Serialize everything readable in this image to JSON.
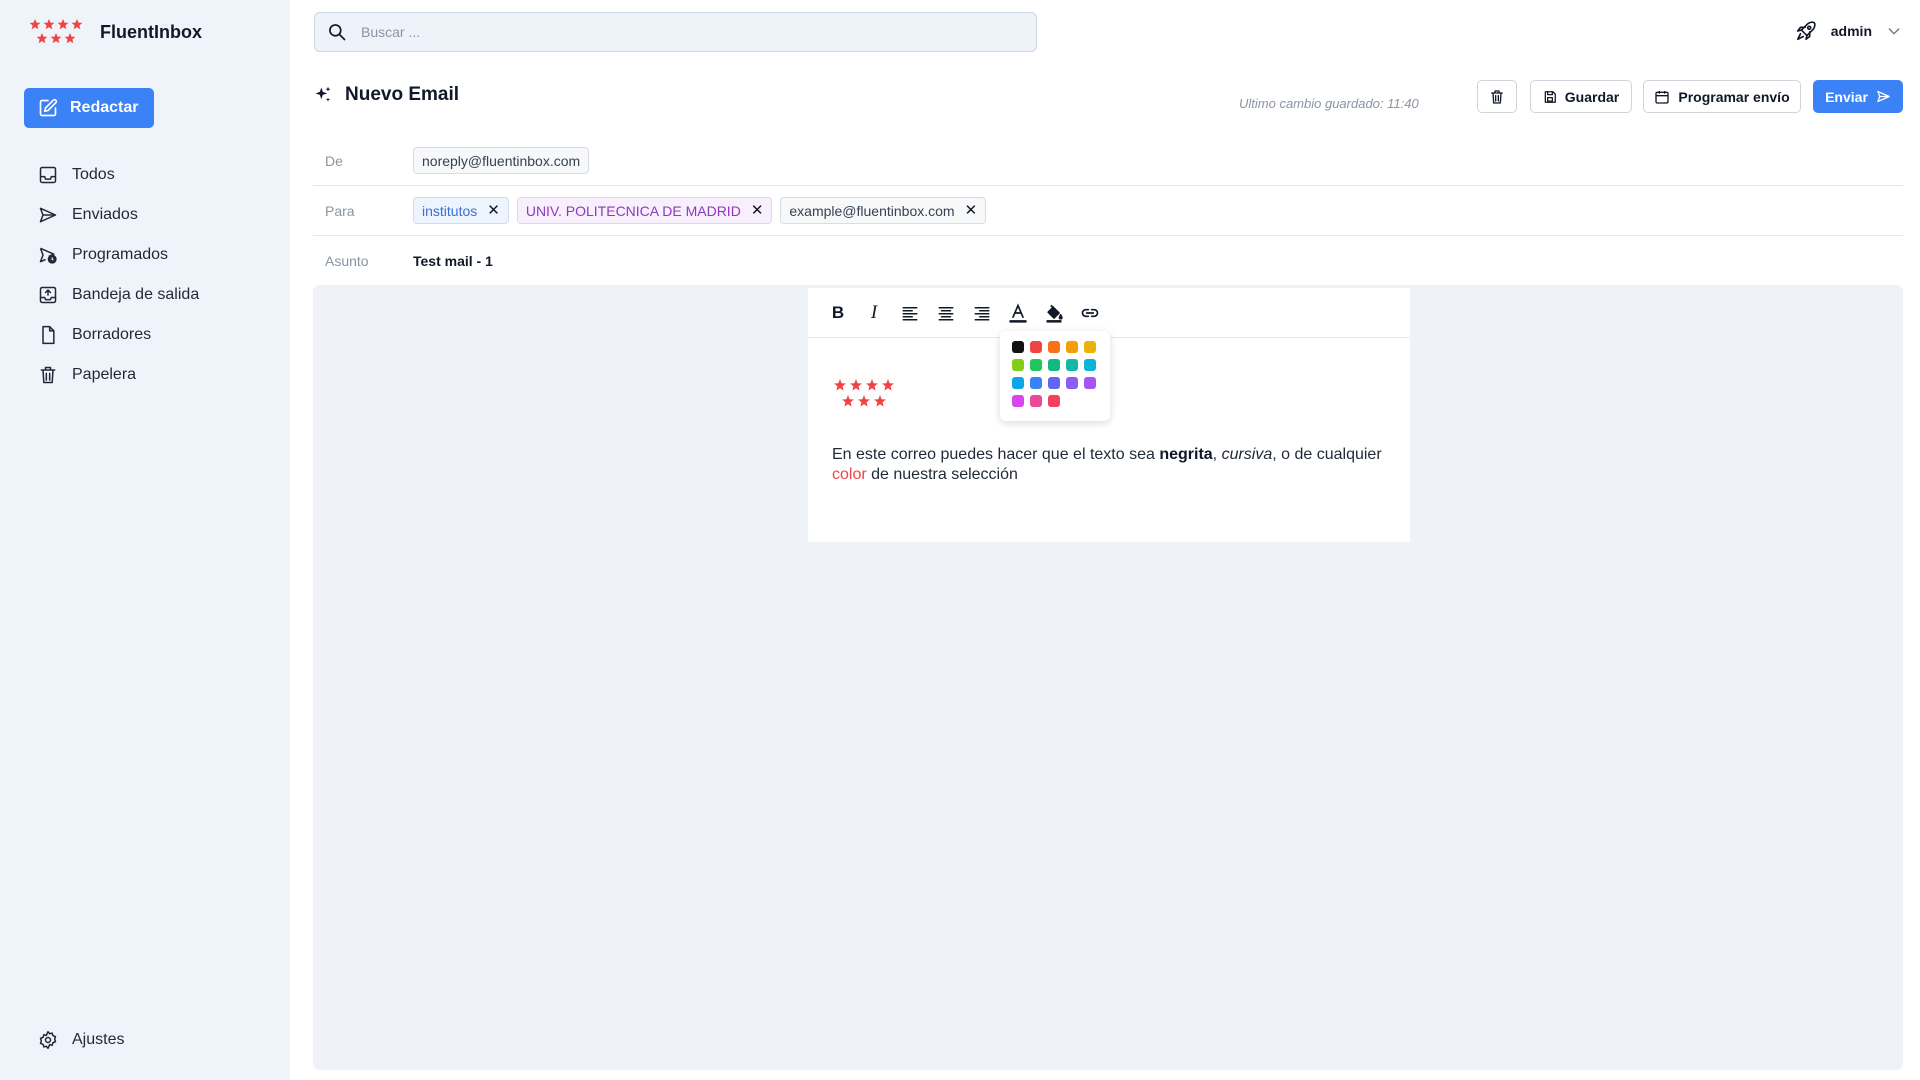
{
  "app": {
    "name": "FluentInbox",
    "brand_color": "#ef4444"
  },
  "sidebar": {
    "compose_label": "Redactar",
    "items": [
      {
        "label": "Todos",
        "icon": "inbox-icon"
      },
      {
        "label": "Enviados",
        "icon": "send-icon"
      },
      {
        "label": "Programados",
        "icon": "scheduled-icon"
      },
      {
        "label": "Bandeja de salida",
        "icon": "outbox-icon"
      },
      {
        "label": "Borradores",
        "icon": "draft-icon"
      },
      {
        "label": "Papelera",
        "icon": "trash-icon"
      }
    ],
    "settings_label": "Ajustes"
  },
  "search": {
    "placeholder": "Buscar ..."
  },
  "user": {
    "name": "admin"
  },
  "compose": {
    "title": "Nuevo Email",
    "saved_note": "Ultimo cambio guardado: 11:40",
    "save_label": "Guardar",
    "schedule_label": "Programar envío",
    "send_label": "Enviar",
    "from_label": "De",
    "from_value": "noreply@fluentinbox.com",
    "to_label": "Para",
    "recipients": [
      "institutos",
      "UNIV. POLITECNICA DE MADRID",
      "example@fluentinbox.com"
    ],
    "subject_label": "Asunto",
    "subject_value": "Test mail - 1"
  },
  "editor": {
    "text_1": "En este correo puedes hacer que el texto sea ",
    "bold_text": "negrita",
    "text_2": ", ",
    "italic_text": "cursiva",
    "text_3": ", o de cualquier ",
    "colored_text": "color",
    "text_4": " de nuestra selección",
    "colored_text_color": "#ef4444"
  },
  "palette": {
    "colors": [
      "#111111",
      "#ef4444",
      "#f97316",
      "#f59e0b",
      "#eab308",
      "#84cc16",
      "#22c55e",
      "#10b981",
      "#14b8a6",
      "#06b6d4",
      "#0ea5e9",
      "#3b82f6",
      "#6366f1",
      "#8b5cf6",
      "#a855f7",
      "#d946ef",
      "#ec4899",
      "#f43f5e"
    ]
  },
  "colors": {
    "accent": "#3b82f6",
    "sidebar_bg": "#eff3fa",
    "editor_bg": "#eff3f8"
  }
}
